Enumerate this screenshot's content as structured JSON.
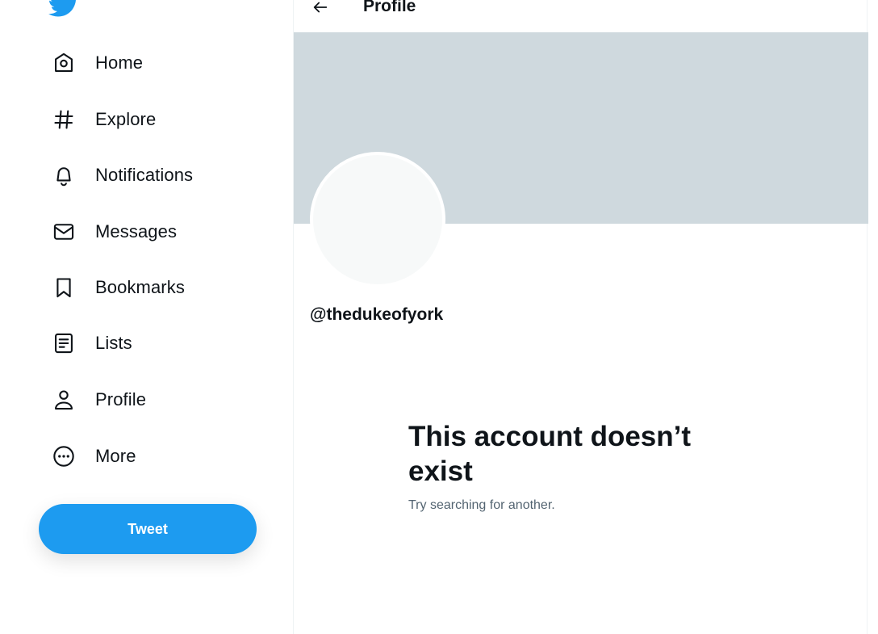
{
  "sidebar": {
    "logo_icon": "twitter-bird-icon",
    "items": [
      {
        "label": "Home",
        "icon": "home-icon"
      },
      {
        "label": "Explore",
        "icon": "hashtag-icon"
      },
      {
        "label": "Notifications",
        "icon": "bell-icon"
      },
      {
        "label": "Messages",
        "icon": "envelope-icon"
      },
      {
        "label": "Bookmarks",
        "icon": "bookmark-icon"
      },
      {
        "label": "Lists",
        "icon": "list-icon"
      },
      {
        "label": "Profile",
        "icon": "person-icon"
      },
      {
        "label": "More",
        "icon": "more-circle-icon"
      }
    ],
    "tweet_label": "Tweet"
  },
  "header": {
    "back_icon": "arrow-left-icon",
    "title": "Profile"
  },
  "profile": {
    "handle": "@thedukeofyork"
  },
  "empty_state": {
    "title": "This account doesn’t exist",
    "subtitle": "Try searching for another."
  },
  "colors": {
    "accent": "#1d9bf0",
    "banner": "#cfd9de",
    "avatar": "#f7f9f9",
    "text_primary": "#0f1419",
    "text_secondary": "#536471"
  }
}
